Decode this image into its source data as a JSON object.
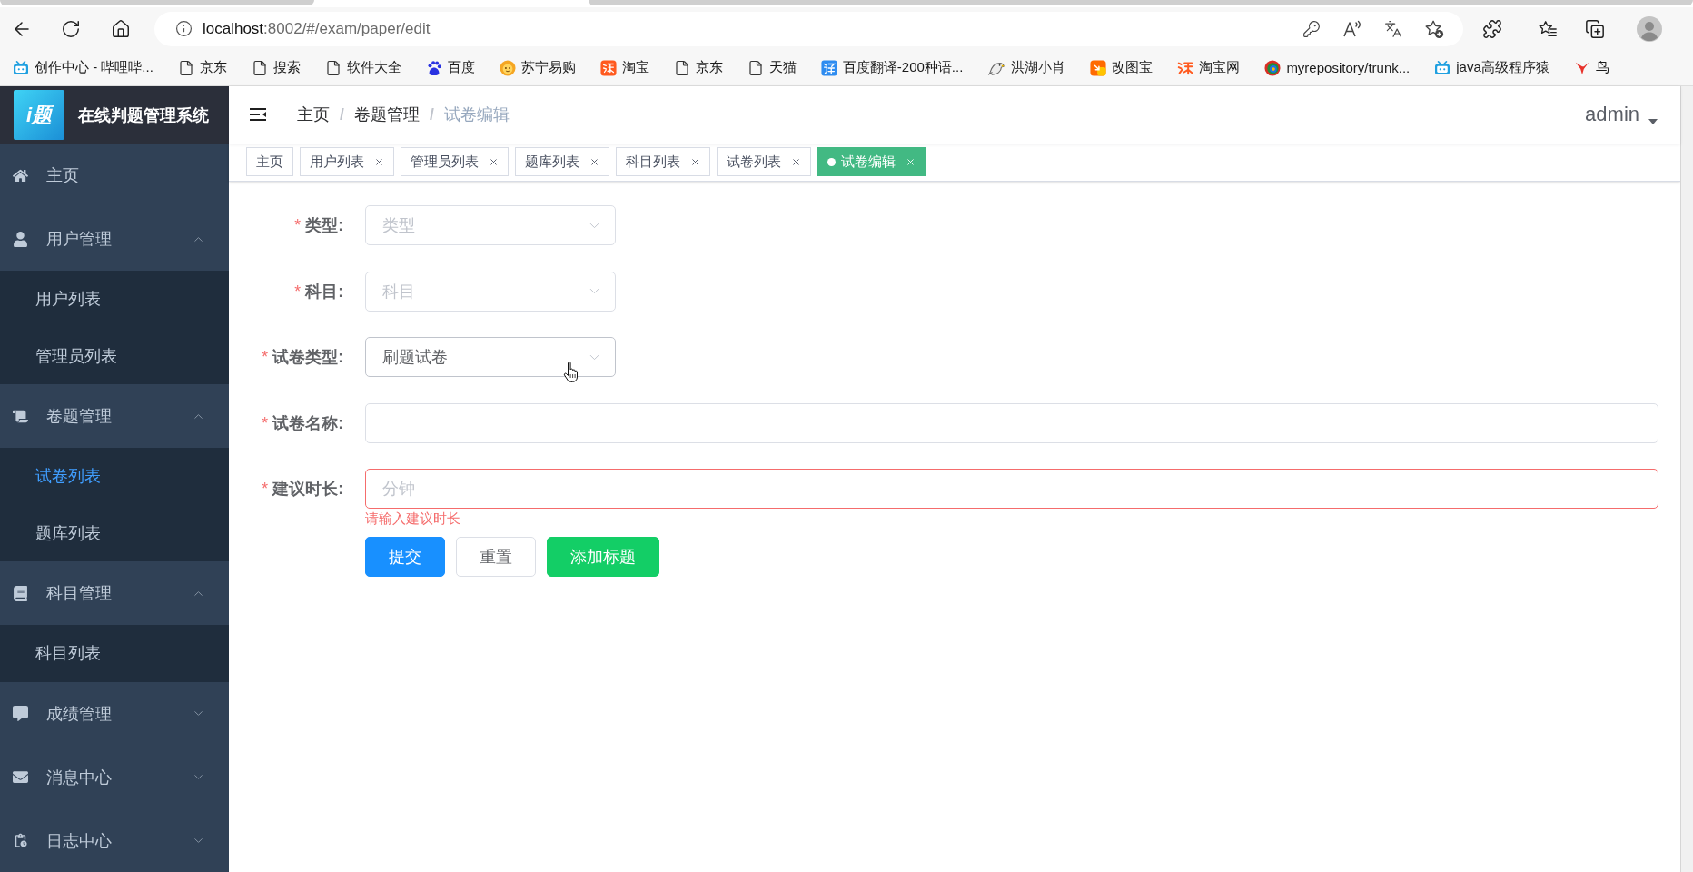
{
  "browser": {
    "url_host": "localhost",
    "url_path": ":8002/#/exam/paper/edit",
    "bookmarks": [
      {
        "label": "创作中心 - 哔哩哔..."
      },
      {
        "label": "京东"
      },
      {
        "label": "搜索"
      },
      {
        "label": "软件大全"
      },
      {
        "label": "百度"
      },
      {
        "label": "苏宁易购"
      },
      {
        "label": "淘宝"
      },
      {
        "label": "京东"
      },
      {
        "label": "天猫"
      },
      {
        "label": "百度翻译-200种语..."
      },
      {
        "label": "洪湖小肖"
      },
      {
        "label": "改图宝"
      },
      {
        "label": "淘宝网"
      },
      {
        "label": "myrepository/trunk..."
      },
      {
        "label": "java高级程序猿"
      },
      {
        "label": "鸟"
      }
    ]
  },
  "sidebar": {
    "logo": "i题",
    "title": "在线判题管理系统",
    "menu": [
      {
        "label": "主页",
        "selected": false
      },
      {
        "label": "用户管理",
        "selected": false,
        "expanded": true,
        "children": [
          {
            "label": "用户列表",
            "selected": false
          },
          {
            "label": "管理员列表",
            "selected": false
          }
        ]
      },
      {
        "label": "卷题管理",
        "selected": false,
        "expanded": true,
        "children": [
          {
            "label": "试卷列表",
            "selected": true
          },
          {
            "label": "题库列表",
            "selected": false
          }
        ]
      },
      {
        "label": "科目管理",
        "selected": false,
        "expanded": true,
        "children": [
          {
            "label": "科目列表",
            "selected": false
          }
        ]
      },
      {
        "label": "成绩管理",
        "selected": false,
        "expanded": false
      },
      {
        "label": "消息中心",
        "selected": false,
        "expanded": false
      },
      {
        "label": "日志中心",
        "selected": false,
        "expanded": false
      }
    ]
  },
  "navbar": {
    "breadcrumb": [
      {
        "label": "主页"
      },
      {
        "separator": "/",
        "label": "卷题管理"
      },
      {
        "separator": "/",
        "label": "试卷编辑"
      }
    ],
    "user": "admin"
  },
  "tags": [
    {
      "label": "主页",
      "selected": false,
      "closable": false
    },
    {
      "label": "用户列表",
      "selected": false,
      "closable": true
    },
    {
      "label": "管理员列表",
      "selected": false,
      "closable": true
    },
    {
      "label": "题库列表",
      "selected": false,
      "closable": true
    },
    {
      "label": "科目列表",
      "selected": false,
      "closable": true
    },
    {
      "label": "试卷列表",
      "selected": false,
      "closable": true
    },
    {
      "label": "试卷编辑",
      "selected": true,
      "closable": true
    }
  ],
  "form": {
    "fields": [
      {
        "kind": "select",
        "required_mark": "*",
        "label": "类型:",
        "placeholder": "类型",
        "hovered": false
      },
      {
        "kind": "select",
        "required_mark": "*",
        "label": "科目:",
        "placeholder": "科目",
        "hovered": false
      },
      {
        "kind": "select",
        "required_mark": "*",
        "label": "试卷类型:",
        "value": "刷题试卷",
        "hovered": true
      },
      {
        "kind": "input",
        "required_mark": "*",
        "label": "试卷名称:"
      },
      {
        "kind": "input",
        "required_mark": "*",
        "label": "建议时长:",
        "placeholder": "分钟",
        "error": "请输入建议时长"
      }
    ],
    "buttons": [
      {
        "label": "提交",
        "kind": "primary"
      },
      {
        "label": "重置",
        "kind": "default"
      },
      {
        "label": "添加标题",
        "kind": "success"
      }
    ]
  }
}
